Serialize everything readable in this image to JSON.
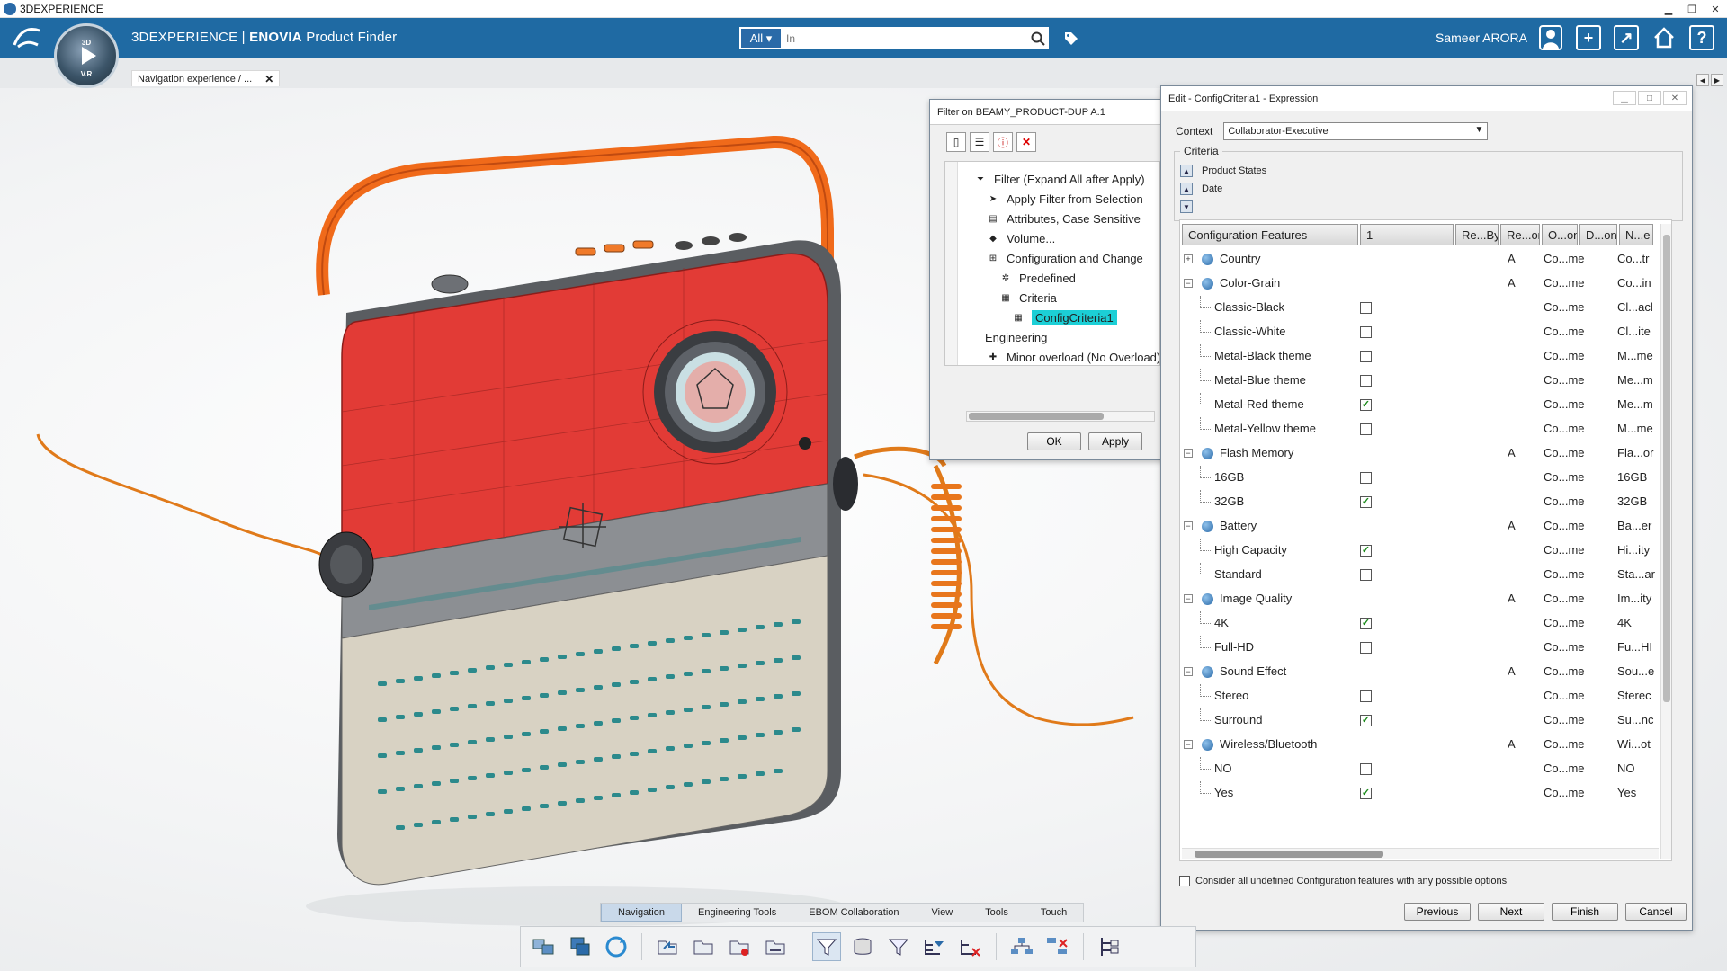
{
  "os": {
    "title": "3DEXPERIENCE"
  },
  "app": {
    "brand_prefix": "3DEXPERIENCE | ",
    "brand_product": "ENOVIA",
    "brand_suffix": " Product Finder",
    "compass_top": "3D",
    "compass_bottom": "V.R",
    "search_scope": "All",
    "search_placeholder": "In",
    "user": "Sameer ARORA"
  },
  "tab": {
    "label": "Navigation experience / ..."
  },
  "filter_dialog": {
    "title": "Filter on BEAMY_PRODUCT-DUP A.1",
    "tree": [
      {
        "label": "Filter (Expand All after Apply)",
        "indent": 0,
        "icon": "filter-icon"
      },
      {
        "label": "Apply Filter from Selection",
        "indent": 1,
        "icon": "pointer-icon"
      },
      {
        "label": "Attributes, Case Sensitive",
        "indent": 1,
        "icon": "table-icon"
      },
      {
        "label": "Volume...",
        "indent": 1,
        "icon": "cube-icon"
      },
      {
        "label": "Configuration and Change",
        "indent": 1,
        "icon": "config-icon"
      },
      {
        "label": "Predefined",
        "indent": 2,
        "icon": "predefined-icon"
      },
      {
        "label": "Criteria",
        "indent": 2,
        "icon": "criteria-icon"
      },
      {
        "label": "ConfigCriteria1",
        "indent": 3,
        "icon": "criteria-item-icon",
        "selected": true
      },
      {
        "label": "Engineering",
        "indent": 1,
        "icon": ""
      },
      {
        "label": "Minor overload (No Overload)",
        "indent": 1,
        "icon": "overload-icon"
      }
    ],
    "ok_label": "OK",
    "apply_label": "Apply"
  },
  "edit_dialog": {
    "title": "Edit - ConfigCriteria1 - Expression",
    "context_label": "Context",
    "context_value": "Collaborator-Executive",
    "criteria_label": "Criteria",
    "criteria_items": [
      "Product States",
      "Date"
    ],
    "columns": [
      "Configuration Features",
      "1",
      "Re...By",
      "Re...on",
      "O...on",
      "D...on",
      "N...e"
    ],
    "rows": [
      {
        "type": "feature",
        "name": "Country",
        "exp": "+",
        "a": "A",
        "o": "Co...me",
        "n": "Co...tr"
      },
      {
        "type": "feature",
        "name": "Color-Grain",
        "exp": "−",
        "a": "A",
        "o": "Co...me",
        "n": "Co...in"
      },
      {
        "type": "option",
        "name": "Classic-Black",
        "checked": "",
        "o": "Co...me",
        "n": "Cl...acl"
      },
      {
        "type": "option",
        "name": "Classic-White",
        "checked": "",
        "o": "Co...me",
        "n": "Cl...ite"
      },
      {
        "type": "option",
        "name": "Metal-Black theme",
        "checked": "",
        "o": "Co...me",
        "n": "M...me"
      },
      {
        "type": "option",
        "name": "Metal-Blue theme",
        "checked": "",
        "o": "Co...me",
        "n": "Me...m"
      },
      {
        "type": "option",
        "name": "Metal-Red theme",
        "checked": "✓",
        "o": "Co...me",
        "n": "Me...m"
      },
      {
        "type": "option",
        "name": "Metal-Yellow theme",
        "checked": "",
        "o": "Co...me",
        "n": "M...me"
      },
      {
        "type": "feature",
        "name": "Flash Memory",
        "exp": "−",
        "a": "A",
        "o": "Co...me",
        "n": "Fla...or"
      },
      {
        "type": "option",
        "name": "16GB",
        "checked": "",
        "o": "Co...me",
        "n": "16GB"
      },
      {
        "type": "option",
        "name": "32GB",
        "checked": "✓",
        "o": "Co...me",
        "n": "32GB"
      },
      {
        "type": "feature",
        "name": "Battery",
        "exp": "−",
        "a": "A",
        "o": "Co...me",
        "n": "Ba...er"
      },
      {
        "type": "option",
        "name": "High Capacity",
        "checked": "✓",
        "o": "Co...me",
        "n": "Hi...ity"
      },
      {
        "type": "option",
        "name": "Standard",
        "checked": "",
        "o": "Co...me",
        "n": "Sta...ar"
      },
      {
        "type": "feature",
        "name": "Image Quality",
        "exp": "−",
        "a": "A",
        "o": "Co...me",
        "n": "Im...ity"
      },
      {
        "type": "option",
        "name": "4K",
        "checked": "✓",
        "o": "Co...me",
        "n": "4K"
      },
      {
        "type": "option",
        "name": "Full-HD",
        "checked": "",
        "o": "Co...me",
        "n": "Fu...HI"
      },
      {
        "type": "feature",
        "name": "Sound Effect",
        "exp": "−",
        "a": "A",
        "o": "Co...me",
        "n": "Sou...e"
      },
      {
        "type": "option",
        "name": "Stereo",
        "checked": "",
        "o": "Co...me",
        "n": "Sterec"
      },
      {
        "type": "option",
        "name": "Surround",
        "checked": "✓",
        "o": "Co...me",
        "n": "Su...nc"
      },
      {
        "type": "feature",
        "name": "Wireless/Bluetooth",
        "exp": "−",
        "a": "A",
        "o": "Co...me",
        "n": "Wi...ot"
      },
      {
        "type": "option",
        "name": "NO",
        "checked": "",
        "o": "Co...me",
        "n": "NO"
      },
      {
        "type": "option",
        "name": "Yes",
        "checked": "✓",
        "o": "Co...me",
        "n": "Yes"
      }
    ],
    "consider_label": "Consider all undefined Configuration features with any possible options",
    "previous_label": "Previous",
    "next_label": "Next",
    "finish_label": "Finish",
    "cancel_label": "Cancel"
  },
  "action_bar": {
    "tabs": [
      "Navigation",
      "Engineering Tools",
      "EBOM Collaboration",
      "View",
      "Tools",
      "Touch"
    ],
    "active_tab": "Navigation"
  },
  "colors": {
    "header": "#1f6aa3",
    "selection": "#1ccfd6",
    "radio_red": "#e23b36",
    "handle_orange": "#f06a1a"
  }
}
